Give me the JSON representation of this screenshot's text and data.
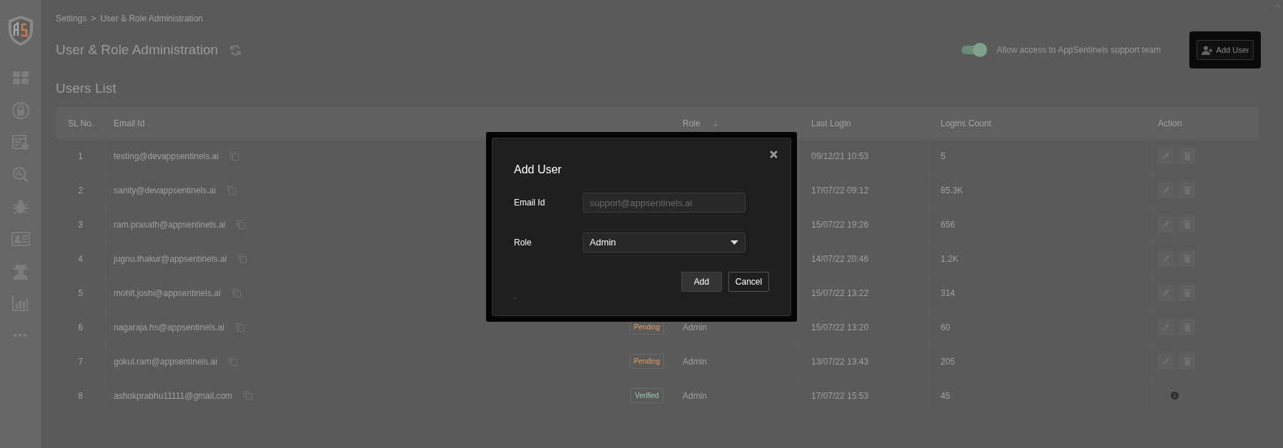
{
  "breadcrumb": {
    "items": [
      "Settings",
      "User & Role Administration"
    ],
    "separator": ">"
  },
  "page_title": "User & Role Administration",
  "support_toggle": {
    "label": "Allow access to AppSentinels support team",
    "on": true
  },
  "add_user_button": "Add User",
  "section_title": "Users List",
  "table": {
    "columns": [
      "SL No.",
      "Email Id",
      "",
      "Role",
      "Last Login",
      "Logins Count",
      "Action"
    ],
    "rows": [
      {
        "sl": "1",
        "email": "testing@devappsentinels.ai",
        "last_login": "09/12/21 10:53",
        "logins_count": "5",
        "kind": "edit_delete"
      },
      {
        "sl": "2",
        "email": "sanity@devappsentinels.ai",
        "last_login": "17/07/22 09:12",
        "logins_count": "85.3K",
        "kind": "edit_delete"
      },
      {
        "sl": "3",
        "email": "ram.prasath@appsentinels.ai",
        "last_login": "15/07/22 19:26",
        "logins_count": "656",
        "kind": "edit_delete"
      },
      {
        "sl": "4",
        "email": "jugnu.thakur@appsentinels.ai",
        "last_login": "14/07/22 20:46",
        "logins_count": "1.2K",
        "kind": "edit_delete"
      },
      {
        "sl": "5",
        "email": "mohit.joshi@appsentinels.ai",
        "last_login": "15/07/22 13:22",
        "logins_count": "314",
        "kind": "edit_delete"
      },
      {
        "sl": "6",
        "email": "nagaraja.hs@appsentinels.ai",
        "status": {
          "text": "Pending",
          "kind": "pending"
        },
        "role": "Admin",
        "last_login": "15/07/22 13:20",
        "logins_count": "60",
        "kind": "edit_delete"
      },
      {
        "sl": "7",
        "email": "gokul.ram@appsentinels.ai",
        "status": {
          "text": "Pending",
          "kind": "pending"
        },
        "role": "Admin",
        "last_login": "13/07/22 13:43",
        "logins_count": "205",
        "kind": "edit_delete"
      },
      {
        "sl": "8",
        "email": "ashokprabhu11111@gmail.com",
        "status": {
          "text": "Verified",
          "kind": "verified"
        },
        "role": "Admin",
        "last_login": "17/07/22 15:53",
        "logins_count": "45",
        "kind": "info"
      }
    ]
  },
  "modal": {
    "title": "Add User",
    "fields": [
      {
        "kind": "text",
        "label": "Email Id",
        "placeholder": "support@appsentinels.ai"
      },
      {
        "kind": "select",
        "label": "Role",
        "value": "Admin"
      }
    ],
    "buttons": [
      {
        "label": "Add",
        "kind": "primary"
      },
      {
        "label": "Cancel",
        "kind": "secondary"
      }
    ],
    "note": "."
  }
}
